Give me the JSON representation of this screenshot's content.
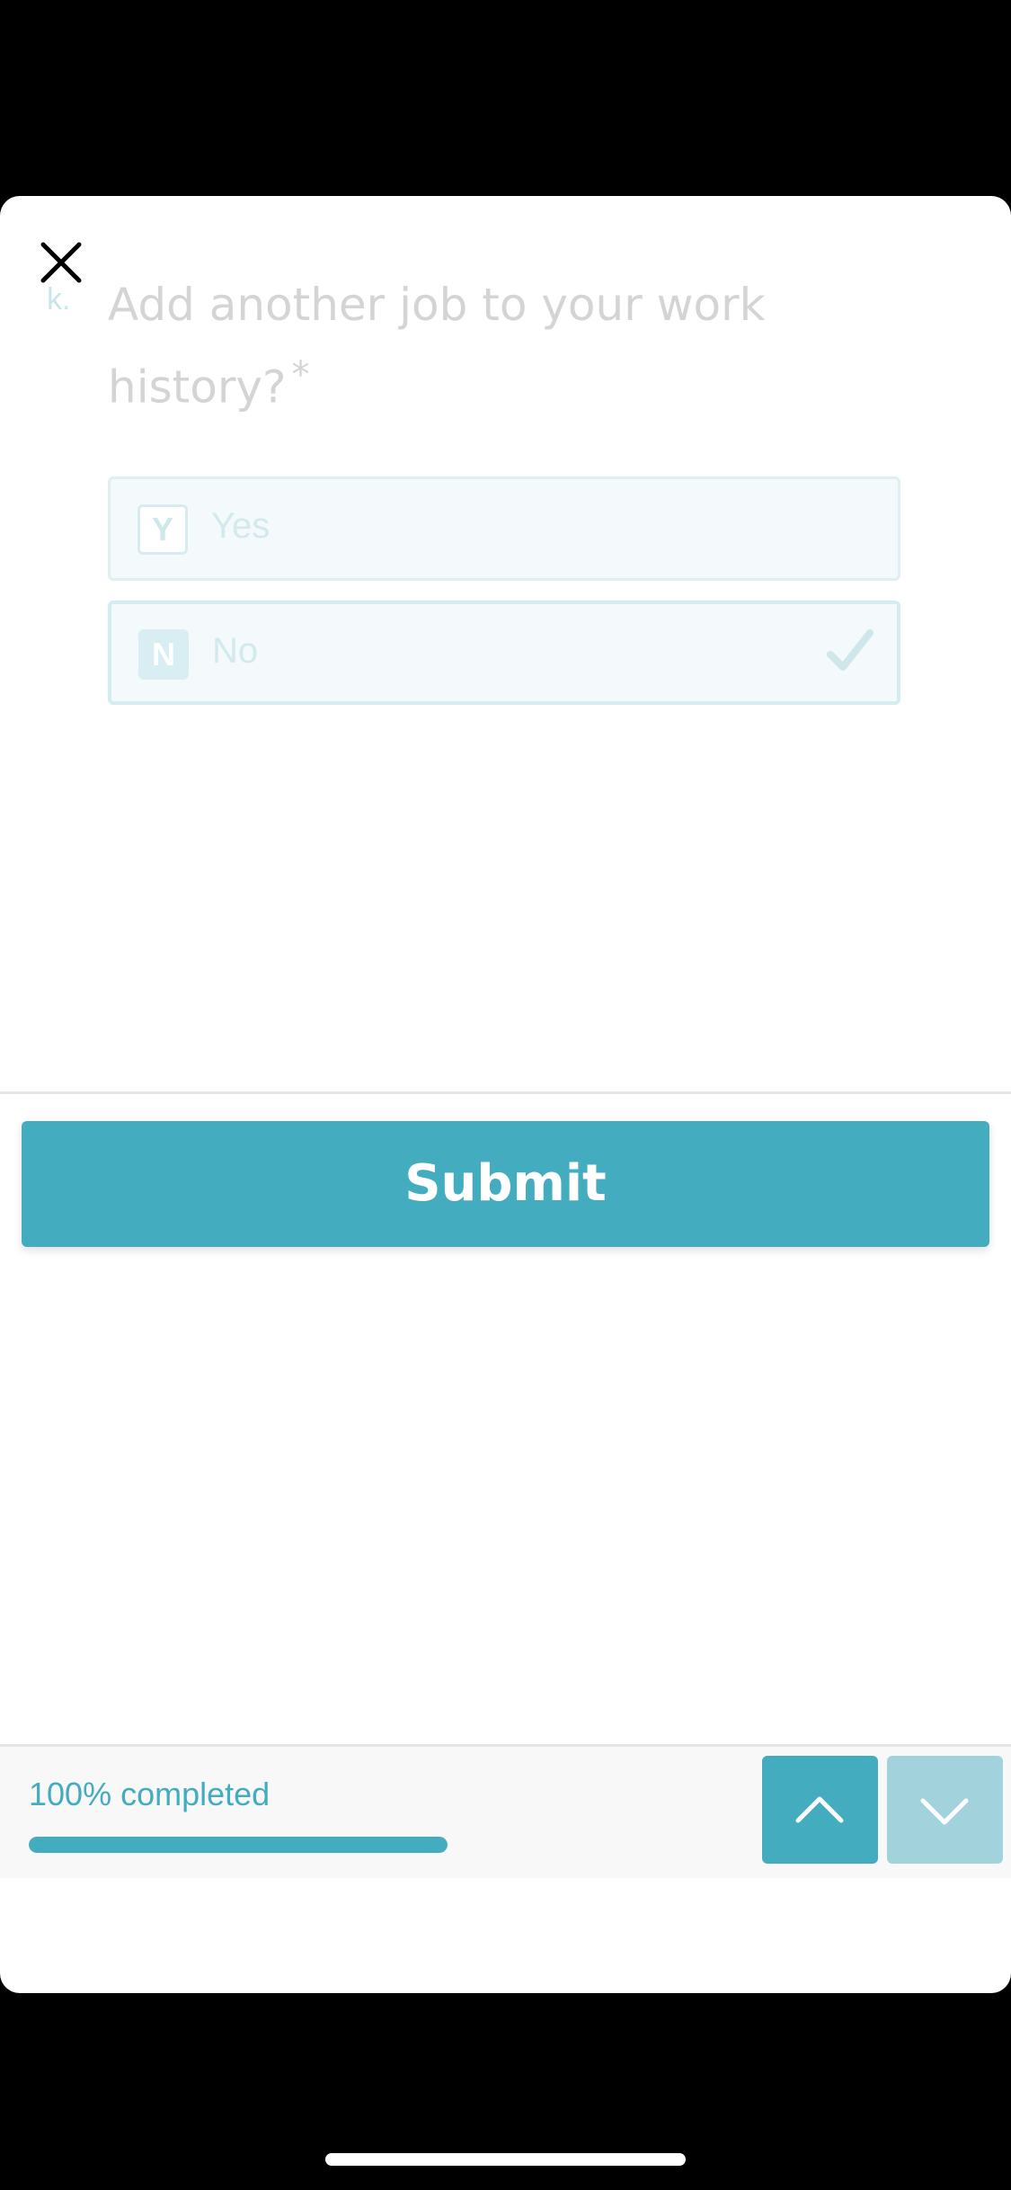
{
  "question": {
    "index": "k.",
    "text": "Add another job to your work history?",
    "required_mark": "*"
  },
  "choices": [
    {
      "key": "Y",
      "label": "Yes",
      "selected": false
    },
    {
      "key": "N",
      "label": "No",
      "selected": true
    }
  ],
  "submit": {
    "label": "Submit"
  },
  "footer": {
    "progress_text": "100% completed",
    "progress_fraction": 1.0
  },
  "icons": {
    "close": "close-icon",
    "check": "check-icon",
    "up": "chevron-up-icon",
    "down": "chevron-down-icon"
  },
  "colors": {
    "accent": "#44acbf",
    "accent_light": "#a2d3dc",
    "background": "#ffffff",
    "frame": "#000000"
  }
}
